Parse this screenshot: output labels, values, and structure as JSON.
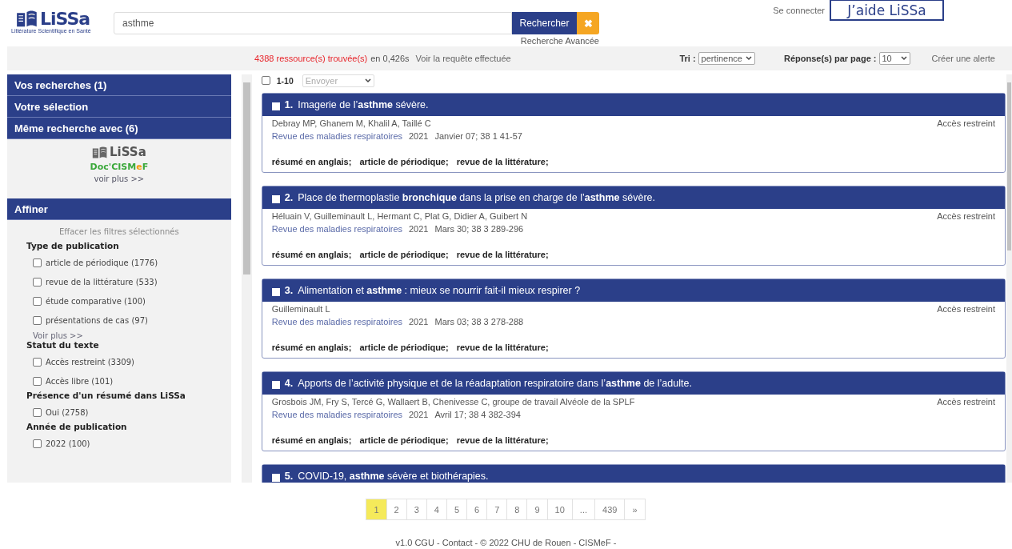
{
  "header": {
    "logo": {
      "name": "LiSSa",
      "subtitle": "Littérature Scientifique en Santé"
    },
    "search": {
      "value": "asthme"
    },
    "search_button": "Rechercher",
    "clear_button": "✖",
    "advanced_link": "Recherche Avancée",
    "login_link": "Se connecter",
    "help_button": "J’aide LiSSa"
  },
  "toolbar": {
    "count": "4388 ressource(s) trouvée(s)",
    "time": "en 0,426s",
    "query_link": "Voir la requête effectuée",
    "sort_label": "Tri :",
    "sort_value": "pertinence",
    "per_page_label": "Réponse(s) par page :",
    "per_page_value": "10",
    "alert_link": "Créer une alerte"
  },
  "sidebar": {
    "sections": [
      {
        "label": "Vos recherches (1)"
      },
      {
        "label": "Votre sélection"
      },
      {
        "label": "Même recherche avec (6)"
      }
    ],
    "same_search": {
      "logo": "LiSSa",
      "doc_cismef": {
        "prefix": "Doc'CISM",
        "accent": "e",
        "suffix": "F"
      },
      "more": "voir plus >>"
    },
    "refine": {
      "title": "Affiner",
      "clear": "Effacer les filtres sélectionnés",
      "groups": [
        {
          "title": "Type de publication",
          "options": [
            {
              "label": "article de périodique (1776)",
              "checked": false
            },
            {
              "label": "revue de la littérature (533)",
              "checked": false
            },
            {
              "label": "étude comparative (100)",
              "checked": false
            },
            {
              "label": "présentations de cas (97)",
              "checked": false
            }
          ],
          "more": "Voir plus >>"
        },
        {
          "title": "Statut du texte",
          "options": [
            {
              "label": "Accès restreint (3309)",
              "checked": false
            },
            {
              "label": "Accès libre (101)",
              "checked": false
            }
          ]
        },
        {
          "title": "Présence d'un résumé dans LiSSa",
          "options": [
            {
              "label": "Oui (2758)",
              "checked": false
            }
          ]
        },
        {
          "title": "Année de publication",
          "options": [
            {
              "label": "2022 (100)",
              "checked": false
            }
          ]
        }
      ]
    }
  },
  "results": {
    "select_all": {
      "label": "1-10",
      "checked": false
    },
    "send_select": "Envoyer",
    "items": [
      {
        "number": "1.",
        "title": "Imagerie de l’**asthme** sévère.",
        "checked": false,
        "authors": "Debray MP, Ghanem M, Khalil A, Taillé C",
        "journal": "Revue des maladies respiratoires",
        "year": "2021",
        "issue": "Janvier 07; 38 1 41-57",
        "access": "Accès restreint",
        "tags": [
          "résumé en anglais;",
          "article de périodique;",
          "revue de la littérature;"
        ]
      },
      {
        "number": "2.",
        "title": "Place de thermoplastie **bronchique** dans la prise en charge de l’**asthme** sévère.",
        "checked": false,
        "authors": "Héluain V, Guilleminault L, Hermant C, Plat G, Didier A, Guibert N",
        "journal": "Revue des maladies respiratoires",
        "year": "2021",
        "issue": "Mars 30; 38 3 289-296",
        "access": "Accès restreint",
        "tags": [
          "résumé en anglais;",
          "article de périodique;",
          "revue de la littérature;"
        ]
      },
      {
        "number": "3.",
        "title": "Alimentation et **asthme** : mieux se nourrir fait-il mieux respirer ?",
        "checked": false,
        "authors": "Guilleminault L",
        "journal": "Revue des maladies respiratoires",
        "year": "2021",
        "issue": "Mars 03; 38 3 278-288",
        "access": "Accès restreint",
        "tags": [
          "résumé en anglais;",
          "article de périodique;",
          "revue de la littérature;"
        ]
      },
      {
        "number": "4.",
        "title": "Apports de l’activité physique et de la réadaptation respiratoire dans l’**asthme** de l’adulte.",
        "checked": false,
        "authors": "Grosbois JM, Fry S, Tercé G, Wallaert B, Chenivesse C, groupe de travail Alvéole de la SPLF",
        "journal": "Revue des maladies respiratoires",
        "year": "2021",
        "issue": "Avril 17; 38 4 382-394",
        "access": "Accès restreint",
        "tags": [
          "résumé en anglais;",
          "article de périodique;",
          "revue de la littérature;"
        ]
      },
      {
        "number": "5.",
        "title": "COVID-19, **asthme** sévère et biothérapies.",
        "checked": false
      }
    ]
  },
  "pagination": [
    {
      "label": "1",
      "selected": true
    },
    {
      "label": "2",
      "selected": false
    },
    {
      "label": "3",
      "selected": false
    },
    {
      "label": "4",
      "selected": false
    },
    {
      "label": "5",
      "selected": false
    },
    {
      "label": "6",
      "selected": false
    },
    {
      "label": "7",
      "selected": false
    },
    {
      "label": "8",
      "selected": false
    },
    {
      "label": "9",
      "selected": false
    },
    {
      "label": "10",
      "selected": false
    },
    {
      "label": "...",
      "selected": false
    },
    {
      "label": "439",
      "selected": false
    },
    {
      "label": "»",
      "selected": false
    }
  ],
  "footer": "v1.0 CGU - Contact - © 2022 CHU de Rouen - CISMeF -"
}
